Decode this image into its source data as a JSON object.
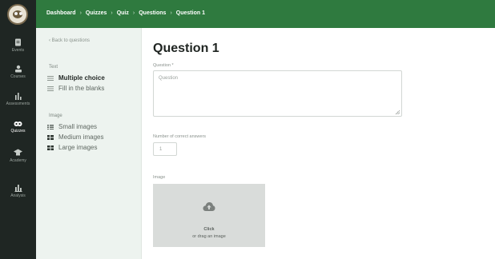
{
  "rail": {
    "items": [
      {
        "label": "Events",
        "icon": "document-icon"
      },
      {
        "label": "Courses",
        "icon": "courses-icon"
      },
      {
        "label": "Assessments",
        "icon": "bar-chart-icon"
      },
      {
        "label": "Quizzes",
        "icon": "quiz-icon",
        "active": true
      },
      {
        "label": "Academy",
        "icon": "graduation-cap-icon"
      },
      {
        "label": "Analysis",
        "icon": "analysis-icon"
      }
    ]
  },
  "breadcrumb": {
    "items": [
      "Dashboard",
      "Quizzes",
      "Quiz",
      "Questions",
      "Question 1"
    ],
    "separator": "›"
  },
  "sidebar": {
    "back": "‹ Back to questions",
    "text_section": "Text",
    "text_options": [
      {
        "label": "Multiple choice",
        "selected": true
      },
      {
        "label": "Fill in the blanks",
        "selected": false
      }
    ],
    "image_section": "Image",
    "image_options": [
      {
        "label": "Small images"
      },
      {
        "label": "Medium images"
      },
      {
        "label": "Large images"
      }
    ]
  },
  "main": {
    "title": "Question 1",
    "question_label": "Question *",
    "question_placeholder": "Question",
    "correct_label": "Number of correct answers",
    "correct_value": "1",
    "image_label": "Image",
    "drop_line1": "Click",
    "drop_line2": "or drag an image"
  },
  "colors": {
    "topbar": "#2f7a3f",
    "rail": "#1f2623",
    "sidebar": "#edf3ef"
  }
}
